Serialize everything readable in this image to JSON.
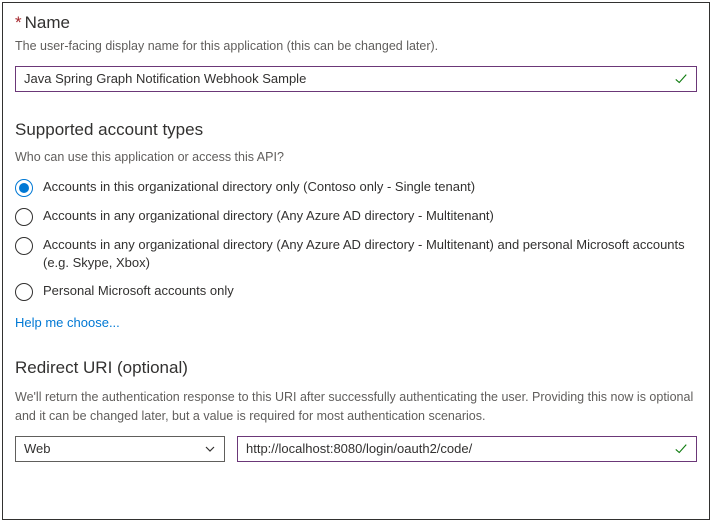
{
  "name": {
    "label": "Name",
    "help": "The user-facing display name for this application (this can be changed later).",
    "value": "Java Spring Graph Notification Webhook Sample"
  },
  "accountTypes": {
    "heading": "Supported account types",
    "question": "Who can use this application or access this API?",
    "options": [
      {
        "label": "Accounts in this organizational directory only (Contoso only - Single tenant)",
        "checked": true
      },
      {
        "label": "Accounts in any organizational directory (Any Azure AD directory - Multitenant)",
        "checked": false
      },
      {
        "label": "Accounts in any organizational directory (Any Azure AD directory - Multitenant) and personal Microsoft accounts (e.g. Skype, Xbox)",
        "checked": false
      },
      {
        "label": "Personal Microsoft accounts only",
        "checked": false
      }
    ],
    "helpLink": "Help me choose..."
  },
  "redirectUri": {
    "heading": "Redirect URI (optional)",
    "help": "We'll return the authentication response to this URI after successfully authenticating the user. Providing this now is optional and it can be changed later, but a value is required for most authentication scenarios.",
    "platform": "Web",
    "value": "http://localhost:8080/login/oauth2/code/"
  },
  "colors": {
    "accentPurple": "#6b3778",
    "accentBlue": "#0078d4",
    "successGreen": "#107c10"
  }
}
